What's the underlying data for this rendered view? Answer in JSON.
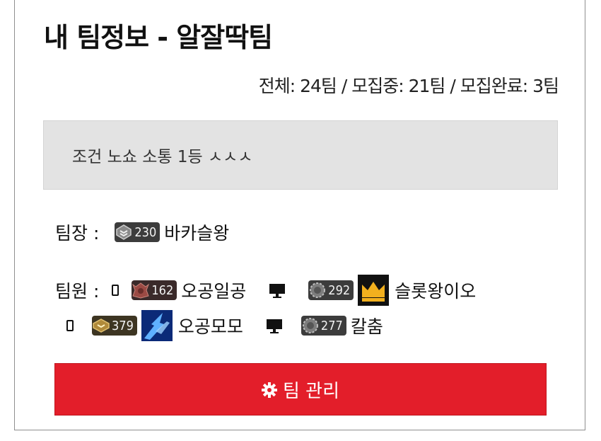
{
  "team": {
    "title": "내 팀정보 - 알잘딱팀",
    "stats": "전체: 24팀 / 모집중: 21팀 / 모집완료: 3팀",
    "description": "조건 노쇼 소통 1등 ㅅㅅㅅ"
  },
  "leader": {
    "label": "팀장 :",
    "level": "230",
    "name": "바카슬왕"
  },
  "members_label": "팀원 :",
  "members": [
    {
      "device": "mobile-icon",
      "level": "162",
      "name": "오공일공"
    },
    {
      "device": "monitor-icon",
      "level": "292",
      "avatar": "crown-avatar",
      "name": "슬롯왕이오"
    },
    {
      "device": "mobile-icon",
      "level": "379",
      "avatar": "blue-energy-avatar",
      "name": "오공모모"
    },
    {
      "device": "monitor-icon",
      "level": "277",
      "name": "칼춤"
    }
  ],
  "manage_button": {
    "label": "팀 관리",
    "icon": "gear-icon"
  },
  "colors": {
    "accent": "#e31e2a",
    "notice_bg": "#e3e3e3",
    "badge_bg": "#3c3c3c"
  }
}
